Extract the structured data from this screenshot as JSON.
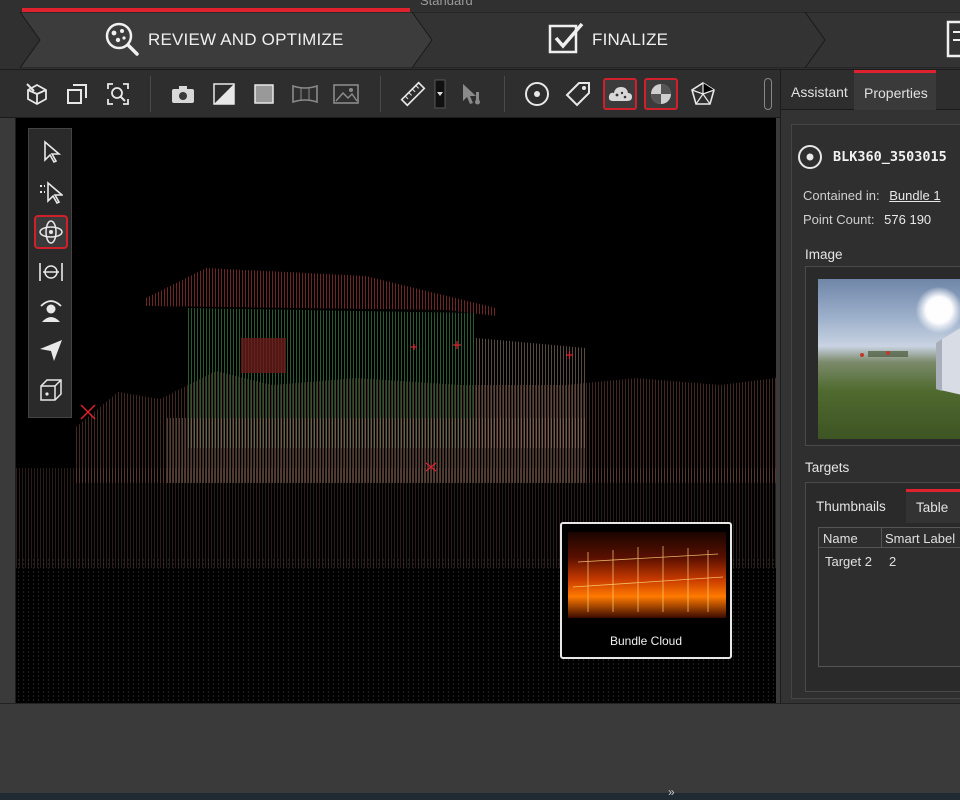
{
  "workflow": {
    "title": "Standard",
    "steps": [
      {
        "label": "REVIEW AND OPTIMIZE",
        "icon": "review-optimize-icon",
        "active": true
      },
      {
        "label": "FINALIZE",
        "icon": "finalize-checkbox-icon",
        "active": false
      },
      {
        "label": "",
        "icon": "report-icon",
        "active": false
      }
    ]
  },
  "toolbar": {
    "items": [
      "import-icon",
      "fit-window-icon",
      "zoom-extents-icon",
      "camera-icon",
      "contrast-icon",
      "square-icon",
      "panorama-icon",
      "image-icon",
      "measure-ruler-icon",
      "dropdown-arrow-icon",
      "probe-pointer-icon",
      "target-circle-icon",
      "tag-icon",
      "cloud-icon",
      "shaded-sphere-icon",
      "mesh-icon"
    ],
    "selected": [
      "cloud-icon",
      "shaded-sphere-icon"
    ]
  },
  "navigation_tools": {
    "items": [
      "select-arrow-icon",
      "multi-select-arrow-icon",
      "orbit-icon",
      "pan-icon",
      "walk-icon",
      "fly-icon",
      "box-view-icon"
    ],
    "selected": "orbit-icon"
  },
  "viewport": {
    "minimap_label": "Bundle Cloud"
  },
  "right_panel": {
    "tabs": [
      "Assistant",
      "Properties"
    ],
    "active_tab": "Properties",
    "object_name": "BLK360_3503015",
    "contained_in_label": "Contained in:",
    "contained_in_value": "Bundle 1",
    "point_count_label": "Point Count:",
    "point_count_value": "576 190",
    "image_section": "Image",
    "targets_section": "Targets",
    "targets_tabs": [
      "Thumbnails",
      "Table"
    ],
    "targets_active_tab": "Table",
    "targets_columns": [
      "Name",
      "Smart Label"
    ],
    "targets_rows": [
      [
        "Target 2",
        "2"
      ]
    ]
  },
  "colors": {
    "accent": "#e0222e",
    "link": "#4aa3e6",
    "viewport_bg": "#000000",
    "panel_bg": "#333333"
  },
  "taskbar": {
    "overflow_glyph": "»"
  }
}
